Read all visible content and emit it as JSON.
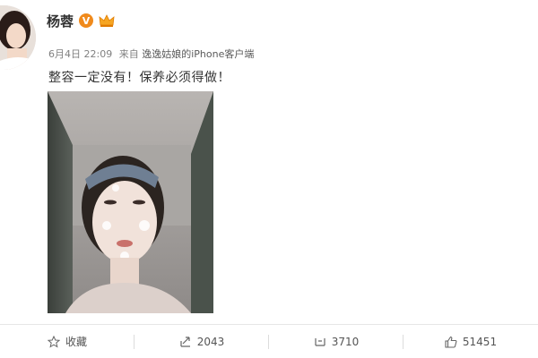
{
  "user": {
    "name": "杨蓉",
    "verified_badge": "V",
    "verified_color": "#f08a1c",
    "crown_icon": "vip-crown-icon"
  },
  "post": {
    "timestamp": "6月4日 22:09",
    "source_prefix": "来自",
    "source_client": "逸逸姑娘的iPhone客户端",
    "text": "整容一定没有！保养必须得做！"
  },
  "actions": {
    "favorite": {
      "label": "收藏",
      "icon": "star-icon"
    },
    "repost": {
      "count": "2043",
      "icon": "repost-icon"
    },
    "comment": {
      "count": "3710",
      "icon": "comment-icon"
    },
    "like": {
      "count": "51451",
      "icon": "thumbs-up-icon"
    }
  }
}
